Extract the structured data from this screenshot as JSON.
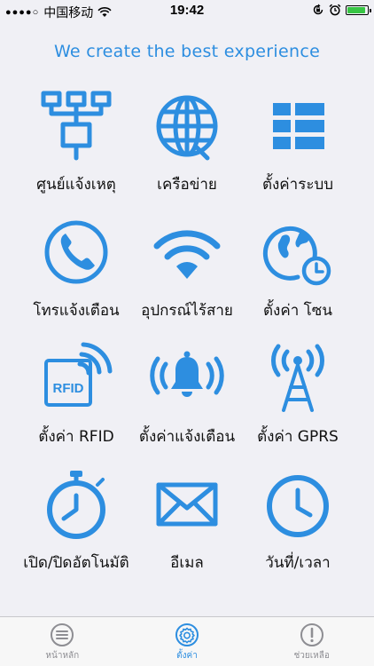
{
  "status_bar": {
    "signal": "●●●●○",
    "carrier": "中国移动",
    "wifi_icon": "wifi-icon",
    "time": "19:42",
    "rotation_lock_icon": "rotation-lock-icon",
    "alarm_icon": "alarm-icon",
    "battery_level": 0.9
  },
  "header": {
    "tagline": "We create the best experience"
  },
  "menu": {
    "items": [
      {
        "label": "ศูนย์แจ้งเหตุ",
        "icon": "network-hierarchy-icon"
      },
      {
        "label": "เครือข่าย",
        "icon": "globe-icon"
      },
      {
        "label": "ตั้งค่าระบบ",
        "icon": "list-view-icon"
      },
      {
        "label": "โทรแจ้งเตือน",
        "icon": "phone-icon"
      },
      {
        "label": "อุปกรณ์ไร้สาย",
        "icon": "wifi-signal-icon"
      },
      {
        "label": "ตั้งค่า โซน",
        "icon": "world-clock-icon"
      },
      {
        "label": "ตั้งค่า RFID",
        "icon": "rfid-card-icon"
      },
      {
        "label": "ตั้งค่าแจ้งเตือน",
        "icon": "bell-alert-icon"
      },
      {
        "label": "ตั้งค่า GPRS",
        "icon": "antenna-icon"
      },
      {
        "label": "เปิด/ปิดอัตโนมัติ",
        "icon": "stopwatch-icon"
      },
      {
        "label": "อีเมล",
        "icon": "envelope-icon"
      },
      {
        "label": "วันที่/เวลา",
        "icon": "clock-icon"
      }
    ],
    "rfid_card_text": "RFID"
  },
  "tab_bar": {
    "tabs": [
      {
        "label": "หน้าหลัก",
        "icon": "menu-icon",
        "active": false
      },
      {
        "label": "ตั้งค่า",
        "icon": "gear-icon",
        "active": true
      },
      {
        "label": "ช่วยเหลือ",
        "icon": "help-icon",
        "active": false
      }
    ]
  },
  "colors": {
    "accent": "#2d8ee0",
    "background": "#f0f0f5",
    "tab_inactive": "#8e8e93"
  }
}
